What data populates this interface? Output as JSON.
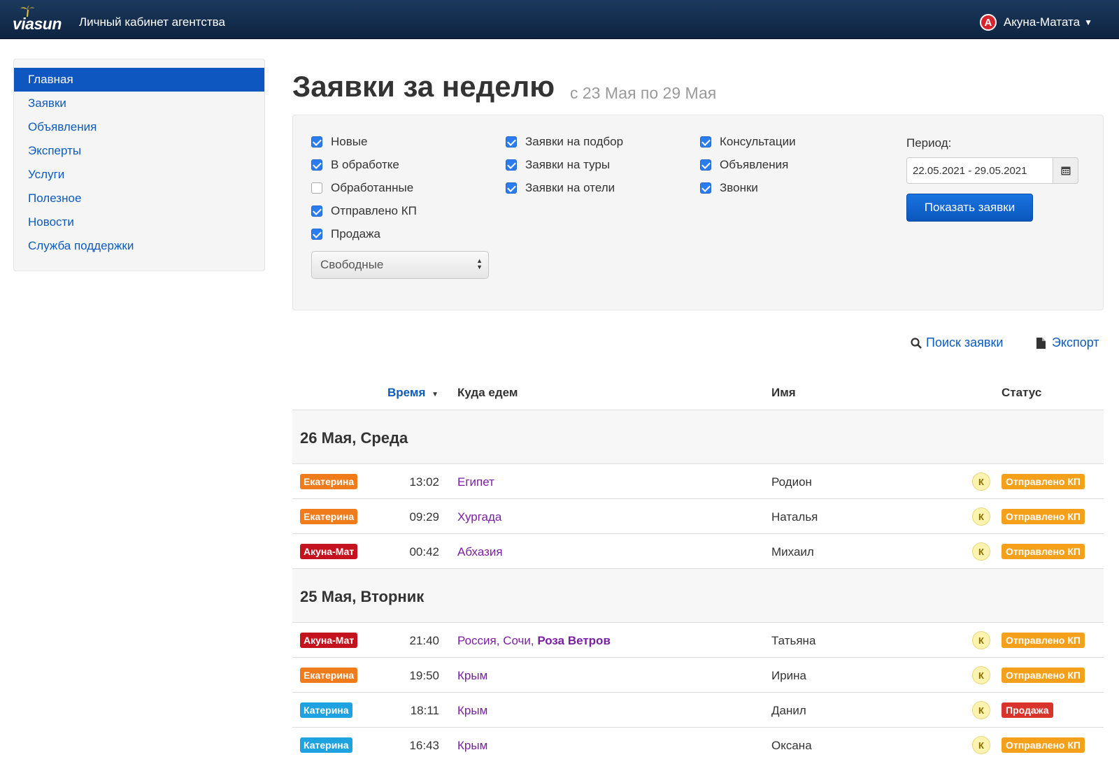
{
  "header": {
    "logo_text": "viasun",
    "brand_title": "Личный кабинет агентства",
    "user_initial": "A",
    "user_name": "Акуна-Матата"
  },
  "sidebar": {
    "items": [
      {
        "label": "Главная",
        "active": true
      },
      {
        "label": "Заявки"
      },
      {
        "label": "Объявления"
      },
      {
        "label": "Эксперты"
      },
      {
        "label": "Услуги"
      },
      {
        "label": "Полезное"
      },
      {
        "label": "Новости"
      },
      {
        "label": "Служба поддержки"
      }
    ]
  },
  "page": {
    "title": "Заявки за неделю",
    "subtitle": "с 23 Мая по 29 Мая"
  },
  "filters": {
    "status_checks": [
      {
        "label": "Новые",
        "checked": true
      },
      {
        "label": "В обработке",
        "checked": true
      },
      {
        "label": "Обработанные",
        "checked": false
      },
      {
        "label": "Отправлено КП",
        "checked": true
      },
      {
        "label": "Продажа",
        "checked": true
      }
    ],
    "type_checks": [
      {
        "label": "Заявки на подбор",
        "checked": true
      },
      {
        "label": "Заявки на туры",
        "checked": true
      },
      {
        "label": "Заявки на отели",
        "checked": true
      }
    ],
    "misc_checks": [
      {
        "label": "Консультации",
        "checked": true
      },
      {
        "label": "Объявления",
        "checked": true
      },
      {
        "label": "Звонки",
        "checked": true
      }
    ],
    "select_value": "Свободные",
    "period_label": "Период:",
    "period_value": "22.05.2021 - 29.05.2021",
    "show_button": "Показать заявки"
  },
  "actions": {
    "search": "Поиск заявки",
    "export": "Экспорт"
  },
  "table": {
    "columns": {
      "time": "Время",
      "dest": "Куда едем",
      "name": "Имя",
      "status": "Статус"
    },
    "groups": [
      {
        "title": "26 Мая, Среда",
        "rows": [
          {
            "agent": "Екатерина",
            "agent_color": "#f07b1a",
            "time": "13:02",
            "dest": "Египет",
            "dest_bold": "",
            "name": "Родион",
            "k": "К",
            "status": "Отправлено КП",
            "status_color": "#f5a01b"
          },
          {
            "agent": "Екатерина",
            "agent_color": "#f07b1a",
            "time": "09:29",
            "dest": "Хургада",
            "dest_bold": "",
            "name": "Наталья",
            "k": "К",
            "status": "Отправлено КП",
            "status_color": "#f5a01b"
          },
          {
            "agent": "Акуна-Мат",
            "agent_color": "#c4121e",
            "time": "00:42",
            "dest": "Абхазия",
            "dest_bold": "",
            "name": "Михаил",
            "k": "К",
            "status": "Отправлено КП",
            "status_color": "#f5a01b"
          }
        ]
      },
      {
        "title": "25 Мая, Вторник",
        "rows": [
          {
            "agent": "Акуна-Мат",
            "agent_color": "#c4121e",
            "time": "21:40",
            "dest": "Россия, Сочи, ",
            "dest_bold": "Роза Ветров",
            "name": "Татьяна",
            "k": "К",
            "status": "Отправлено КП",
            "status_color": "#f5a01b"
          },
          {
            "agent": "Екатерина",
            "agent_color": "#f07b1a",
            "time": "19:50",
            "dest": "Крым",
            "dest_bold": "",
            "name": "Ирина",
            "k": "К",
            "status": "Отправлено КП",
            "status_color": "#f5a01b"
          },
          {
            "agent": "Катерина",
            "agent_color": "#1fa3e0",
            "time": "18:11",
            "dest": "Крым",
            "dest_bold": "",
            "name": "Данил",
            "k": "К",
            "status": "Продажа",
            "status_color": "#d9342b"
          },
          {
            "agent": "Катерина",
            "agent_color": "#1fa3e0",
            "time": "16:43",
            "dest": "Крым",
            "dest_bold": "",
            "name": "Оксана",
            "k": "К",
            "status": "Отправлено КП",
            "status_color": "#f5a01b"
          }
        ]
      }
    ]
  }
}
